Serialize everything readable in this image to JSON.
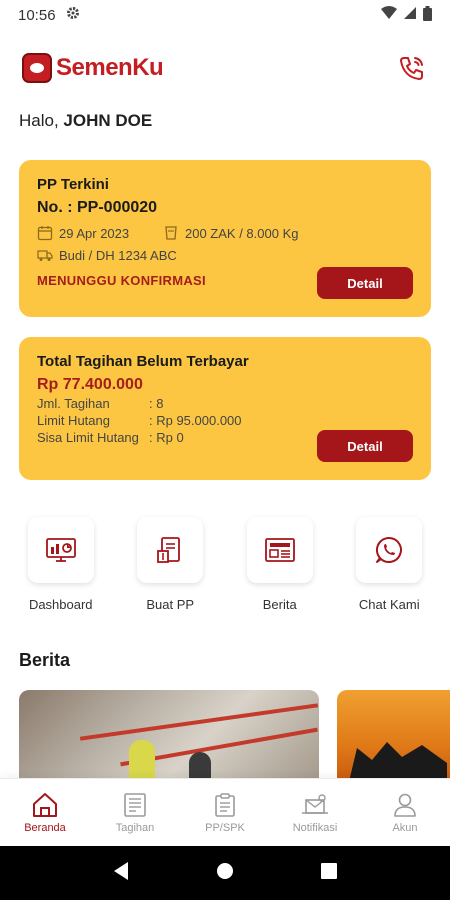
{
  "status_bar": {
    "time": "10:56"
  },
  "brand": {
    "name": "SemenKu",
    "color": "#c41e23"
  },
  "greeting": {
    "prefix": "Halo,",
    "name": "JOHN DOE"
  },
  "pp_card": {
    "title": "PP Terkini",
    "number": "No. : PP-000020",
    "date": "29 Apr 2023",
    "quantity": "200 ZAK / 8.000 Kg",
    "driver": "Budi / DH 1234 ABC",
    "status": "MENUNGGU KONFIRMASI",
    "detail_label": "Detail"
  },
  "bill_card": {
    "title": "Total Tagihan Belum Terbayar",
    "amount": "Rp 77.400.000",
    "rows": [
      {
        "key": "Jml. Tagihan",
        "value": ": 8"
      },
      {
        "key": "Limit Hutang",
        "value": ": Rp 95.000.000"
      },
      {
        "key": "Sisa Limit Hutang",
        "value": ": Rp 0"
      }
    ],
    "detail_label": "Detail"
  },
  "menu": [
    {
      "label": "Dashboard",
      "icon": "dashboard-icon"
    },
    {
      "label": "Buat PP",
      "icon": "create-order-icon"
    },
    {
      "label": "Berita",
      "icon": "news-icon"
    },
    {
      "label": "Chat Kami",
      "icon": "whatsapp-icon"
    }
  ],
  "news_section": {
    "title": "Berita"
  },
  "bottom_nav": [
    {
      "label": "Beranda",
      "icon": "home-icon",
      "active": true
    },
    {
      "label": "Tagihan",
      "icon": "invoice-icon",
      "active": false
    },
    {
      "label": "PP/SPK",
      "icon": "clipboard-icon",
      "active": false
    },
    {
      "label": "Notifikasi",
      "icon": "notification-icon",
      "active": false
    },
    {
      "label": "Akun",
      "icon": "user-icon",
      "active": false
    }
  ],
  "colors": {
    "card": "#fcc642",
    "accent": "#a5161b"
  }
}
